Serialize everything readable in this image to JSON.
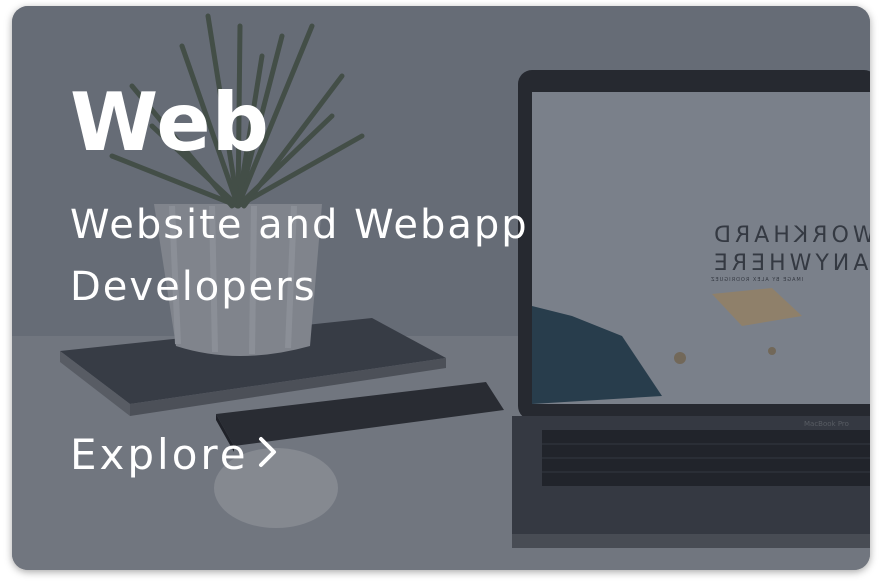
{
  "card": {
    "title": "Web",
    "subtitle": "Website and Webapp Developers",
    "cta_label": "Explore",
    "cta_icon": "chevron-right-icon"
  },
  "laptop_screen": {
    "line1": "WORKHARD",
    "line2": "ANYWHERE",
    "caption": "IMAGE BY ALEX RODRIGUEZ"
  },
  "laptop_brand": "MacBook Pro",
  "colors": {
    "overlay": "#282e3c",
    "text": "#ffffff"
  }
}
